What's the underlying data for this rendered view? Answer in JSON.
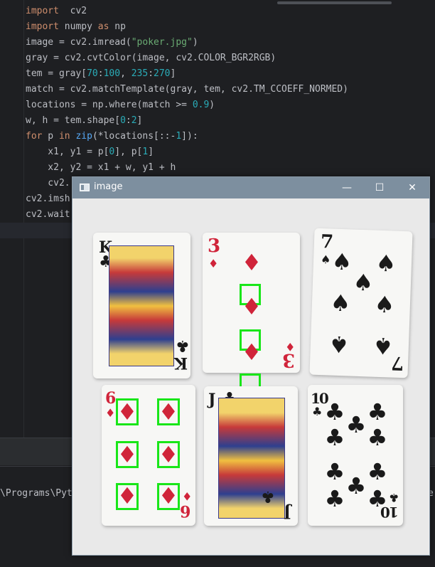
{
  "editor": {
    "lines": [
      [
        [
          "kw",
          "import"
        ],
        [
          "",
          "  cv2"
        ]
      ],
      [
        [
          "kw",
          "import"
        ],
        [
          "",
          " numpy "
        ],
        [
          "kw",
          "as"
        ],
        [
          "",
          " np"
        ]
      ],
      [
        [
          "",
          "image = cv2.imread("
        ],
        [
          "str",
          "\"poker.jpg\""
        ],
        [
          "",
          ")"
        ]
      ],
      [
        [
          "",
          "gray = cv2.cvtColor(image, cv2.COLOR_BGR2RGB)"
        ]
      ],
      [
        [
          "",
          "tem = gray["
        ],
        [
          "num",
          "70"
        ],
        [
          "",
          ":"
        ],
        [
          "num",
          "100"
        ],
        [
          "",
          ", "
        ],
        [
          "num",
          "235"
        ],
        [
          "",
          ":"
        ],
        [
          "num",
          "270"
        ],
        [
          "",
          "]"
        ]
      ],
      [
        [
          "",
          "match = cv2.matchTemplate(gray, tem, cv2.TM_CCOEFF_NORMED)"
        ]
      ],
      [
        [
          "",
          "locations = np.where(match >= "
        ],
        [
          "num",
          "0.9"
        ],
        [
          "",
          ")"
        ]
      ],
      [
        [
          "",
          "w, h = tem.shape["
        ],
        [
          "num",
          "0"
        ],
        [
          "",
          ":"
        ],
        [
          "num",
          "2"
        ],
        [
          "",
          "]"
        ]
      ],
      [
        [
          "kw",
          "for"
        ],
        [
          "",
          " p "
        ],
        [
          "kw",
          "in"
        ],
        [
          "",
          ""
        ],
        [
          "fn",
          " zip"
        ],
        [
          "",
          "(*locations[::-"
        ],
        [
          "num",
          "1"
        ],
        [
          "",
          "]):"
        ]
      ],
      [
        [
          "",
          "    x1, y1 = p["
        ],
        [
          "num",
          "0"
        ],
        [
          "",
          "], p["
        ],
        [
          "num",
          "1"
        ],
        [
          "",
          "]"
        ]
      ],
      [
        [
          "",
          "    x2, y2 = x1 + w, y1 + h"
        ]
      ],
      [
        [
          "",
          "    cv2."
        ]
      ],
      [
        [
          "",
          "cv2.imsh"
        ]
      ],
      [
        [
          "",
          "cv2.wait"
        ]
      ],
      [
        [
          "",
          ""
        ]
      ]
    ]
  },
  "terminal": {
    "path_text": "\\Programs\\Pyt",
    "right_fragment": "e"
  },
  "window": {
    "title": "image",
    "minimize": "—",
    "maximize": "☐",
    "close": "✕"
  },
  "cards": {
    "king_clubs": {
      "rank": "K",
      "suit": "♣"
    },
    "three_diamonds": {
      "rank": "3",
      "suit": "♦"
    },
    "seven_spades": {
      "rank": "7",
      "suit": "♠"
    },
    "six_diamonds": {
      "rank": "6",
      "suit": "♦"
    },
    "jack_clubs": {
      "rank": "J",
      "suit": "♣"
    },
    "ten_clubs": {
      "rank": "10",
      "suit": "♣"
    }
  },
  "colors": {
    "match_box": "#19e619",
    "red_suit": "#d0243a",
    "keyword": "#cf8e6d",
    "string": "#6aab73",
    "number": "#2aacb8"
  }
}
